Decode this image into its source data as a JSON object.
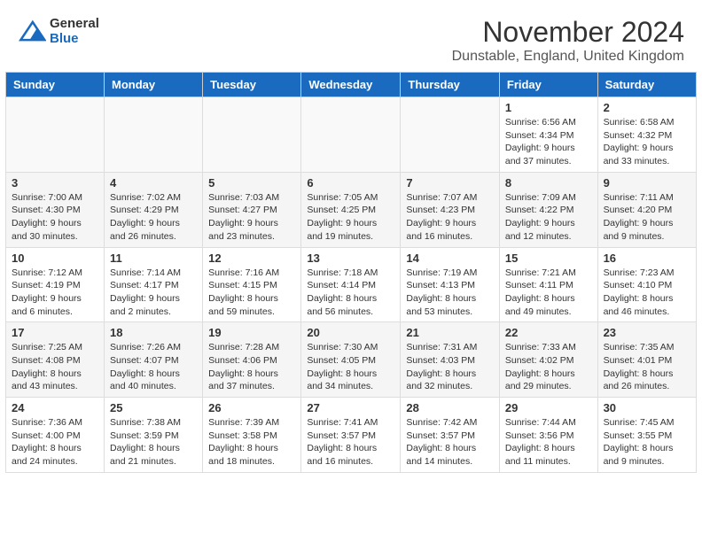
{
  "header": {
    "logo": {
      "general": "General",
      "blue": "Blue"
    },
    "month": "November 2024",
    "location": "Dunstable, England, United Kingdom"
  },
  "calendar": {
    "days_of_week": [
      "Sunday",
      "Monday",
      "Tuesday",
      "Wednesday",
      "Thursday",
      "Friday",
      "Saturday"
    ],
    "weeks": [
      [
        {
          "day": "",
          "info": ""
        },
        {
          "day": "",
          "info": ""
        },
        {
          "day": "",
          "info": ""
        },
        {
          "day": "",
          "info": ""
        },
        {
          "day": "",
          "info": ""
        },
        {
          "day": "1",
          "info": "Sunrise: 6:56 AM\nSunset: 4:34 PM\nDaylight: 9 hours and 37 minutes."
        },
        {
          "day": "2",
          "info": "Sunrise: 6:58 AM\nSunset: 4:32 PM\nDaylight: 9 hours and 33 minutes."
        }
      ],
      [
        {
          "day": "3",
          "info": "Sunrise: 7:00 AM\nSunset: 4:30 PM\nDaylight: 9 hours and 30 minutes."
        },
        {
          "day": "4",
          "info": "Sunrise: 7:02 AM\nSunset: 4:29 PM\nDaylight: 9 hours and 26 minutes."
        },
        {
          "day": "5",
          "info": "Sunrise: 7:03 AM\nSunset: 4:27 PM\nDaylight: 9 hours and 23 minutes."
        },
        {
          "day": "6",
          "info": "Sunrise: 7:05 AM\nSunset: 4:25 PM\nDaylight: 9 hours and 19 minutes."
        },
        {
          "day": "7",
          "info": "Sunrise: 7:07 AM\nSunset: 4:23 PM\nDaylight: 9 hours and 16 minutes."
        },
        {
          "day": "8",
          "info": "Sunrise: 7:09 AM\nSunset: 4:22 PM\nDaylight: 9 hours and 12 minutes."
        },
        {
          "day": "9",
          "info": "Sunrise: 7:11 AM\nSunset: 4:20 PM\nDaylight: 9 hours and 9 minutes."
        }
      ],
      [
        {
          "day": "10",
          "info": "Sunrise: 7:12 AM\nSunset: 4:19 PM\nDaylight: 9 hours and 6 minutes."
        },
        {
          "day": "11",
          "info": "Sunrise: 7:14 AM\nSunset: 4:17 PM\nDaylight: 9 hours and 2 minutes."
        },
        {
          "day": "12",
          "info": "Sunrise: 7:16 AM\nSunset: 4:15 PM\nDaylight: 8 hours and 59 minutes."
        },
        {
          "day": "13",
          "info": "Sunrise: 7:18 AM\nSunset: 4:14 PM\nDaylight: 8 hours and 56 minutes."
        },
        {
          "day": "14",
          "info": "Sunrise: 7:19 AM\nSunset: 4:13 PM\nDaylight: 8 hours and 53 minutes."
        },
        {
          "day": "15",
          "info": "Sunrise: 7:21 AM\nSunset: 4:11 PM\nDaylight: 8 hours and 49 minutes."
        },
        {
          "day": "16",
          "info": "Sunrise: 7:23 AM\nSunset: 4:10 PM\nDaylight: 8 hours and 46 minutes."
        }
      ],
      [
        {
          "day": "17",
          "info": "Sunrise: 7:25 AM\nSunset: 4:08 PM\nDaylight: 8 hours and 43 minutes."
        },
        {
          "day": "18",
          "info": "Sunrise: 7:26 AM\nSunset: 4:07 PM\nDaylight: 8 hours and 40 minutes."
        },
        {
          "day": "19",
          "info": "Sunrise: 7:28 AM\nSunset: 4:06 PM\nDaylight: 8 hours and 37 minutes."
        },
        {
          "day": "20",
          "info": "Sunrise: 7:30 AM\nSunset: 4:05 PM\nDaylight: 8 hours and 34 minutes."
        },
        {
          "day": "21",
          "info": "Sunrise: 7:31 AM\nSunset: 4:03 PM\nDaylight: 8 hours and 32 minutes."
        },
        {
          "day": "22",
          "info": "Sunrise: 7:33 AM\nSunset: 4:02 PM\nDaylight: 8 hours and 29 minutes."
        },
        {
          "day": "23",
          "info": "Sunrise: 7:35 AM\nSunset: 4:01 PM\nDaylight: 8 hours and 26 minutes."
        }
      ],
      [
        {
          "day": "24",
          "info": "Sunrise: 7:36 AM\nSunset: 4:00 PM\nDaylight: 8 hours and 24 minutes."
        },
        {
          "day": "25",
          "info": "Sunrise: 7:38 AM\nSunset: 3:59 PM\nDaylight: 8 hours and 21 minutes."
        },
        {
          "day": "26",
          "info": "Sunrise: 7:39 AM\nSunset: 3:58 PM\nDaylight: 8 hours and 18 minutes."
        },
        {
          "day": "27",
          "info": "Sunrise: 7:41 AM\nSunset: 3:57 PM\nDaylight: 8 hours and 16 minutes."
        },
        {
          "day": "28",
          "info": "Sunrise: 7:42 AM\nSunset: 3:57 PM\nDaylight: 8 hours and 14 minutes."
        },
        {
          "day": "29",
          "info": "Sunrise: 7:44 AM\nSunset: 3:56 PM\nDaylight: 8 hours and 11 minutes."
        },
        {
          "day": "30",
          "info": "Sunrise: 7:45 AM\nSunset: 3:55 PM\nDaylight: 8 hours and 9 minutes."
        }
      ]
    ]
  }
}
